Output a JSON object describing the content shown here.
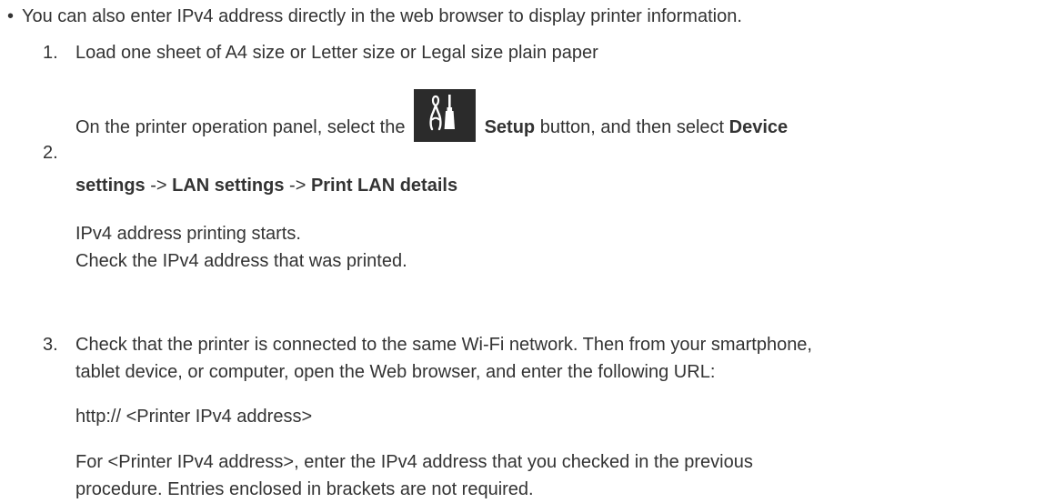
{
  "intro": {
    "bullet": "•",
    "text": "You can also enter IPv4 address directly in the web browser to display printer information."
  },
  "steps": [
    {
      "number": "1.",
      "text": "Load one sheet of A4 size or Letter size or Legal size plain paper"
    },
    {
      "number": "2.",
      "pre_text": "On the printer operation panel, select the",
      "icon": "setup-tools-icon",
      "setup_label": "Setup",
      "mid_text": " button, and then select ",
      "device_label": "Device",
      "settings_label": "settings",
      "arrow1": " -> ",
      "lan_label": "LAN settings",
      "arrow2": " -> ",
      "print_label": "Print LAN details",
      "note_line1": "IPv4 address printing starts.",
      "note_line2": "Check the IPv4 address that was printed."
    },
    {
      "number": "3.",
      "line1": "Check that the printer is connected to the same Wi-Fi network. Then from your smartphone,",
      "line2": "tablet device, or computer, open the Web browser, and enter the following URL:",
      "url": "http:// <Printer IPv4 address>",
      "note_line1": "For <Printer IPv4 address>, enter the IPv4 address that you checked in the previous",
      "note_line2": "procedure. Entries enclosed in brackets are not required."
    }
  ],
  "colors": {
    "text": "#333333",
    "icon_bg": "#2b2b2b",
    "icon_fg": "#ffffff"
  }
}
